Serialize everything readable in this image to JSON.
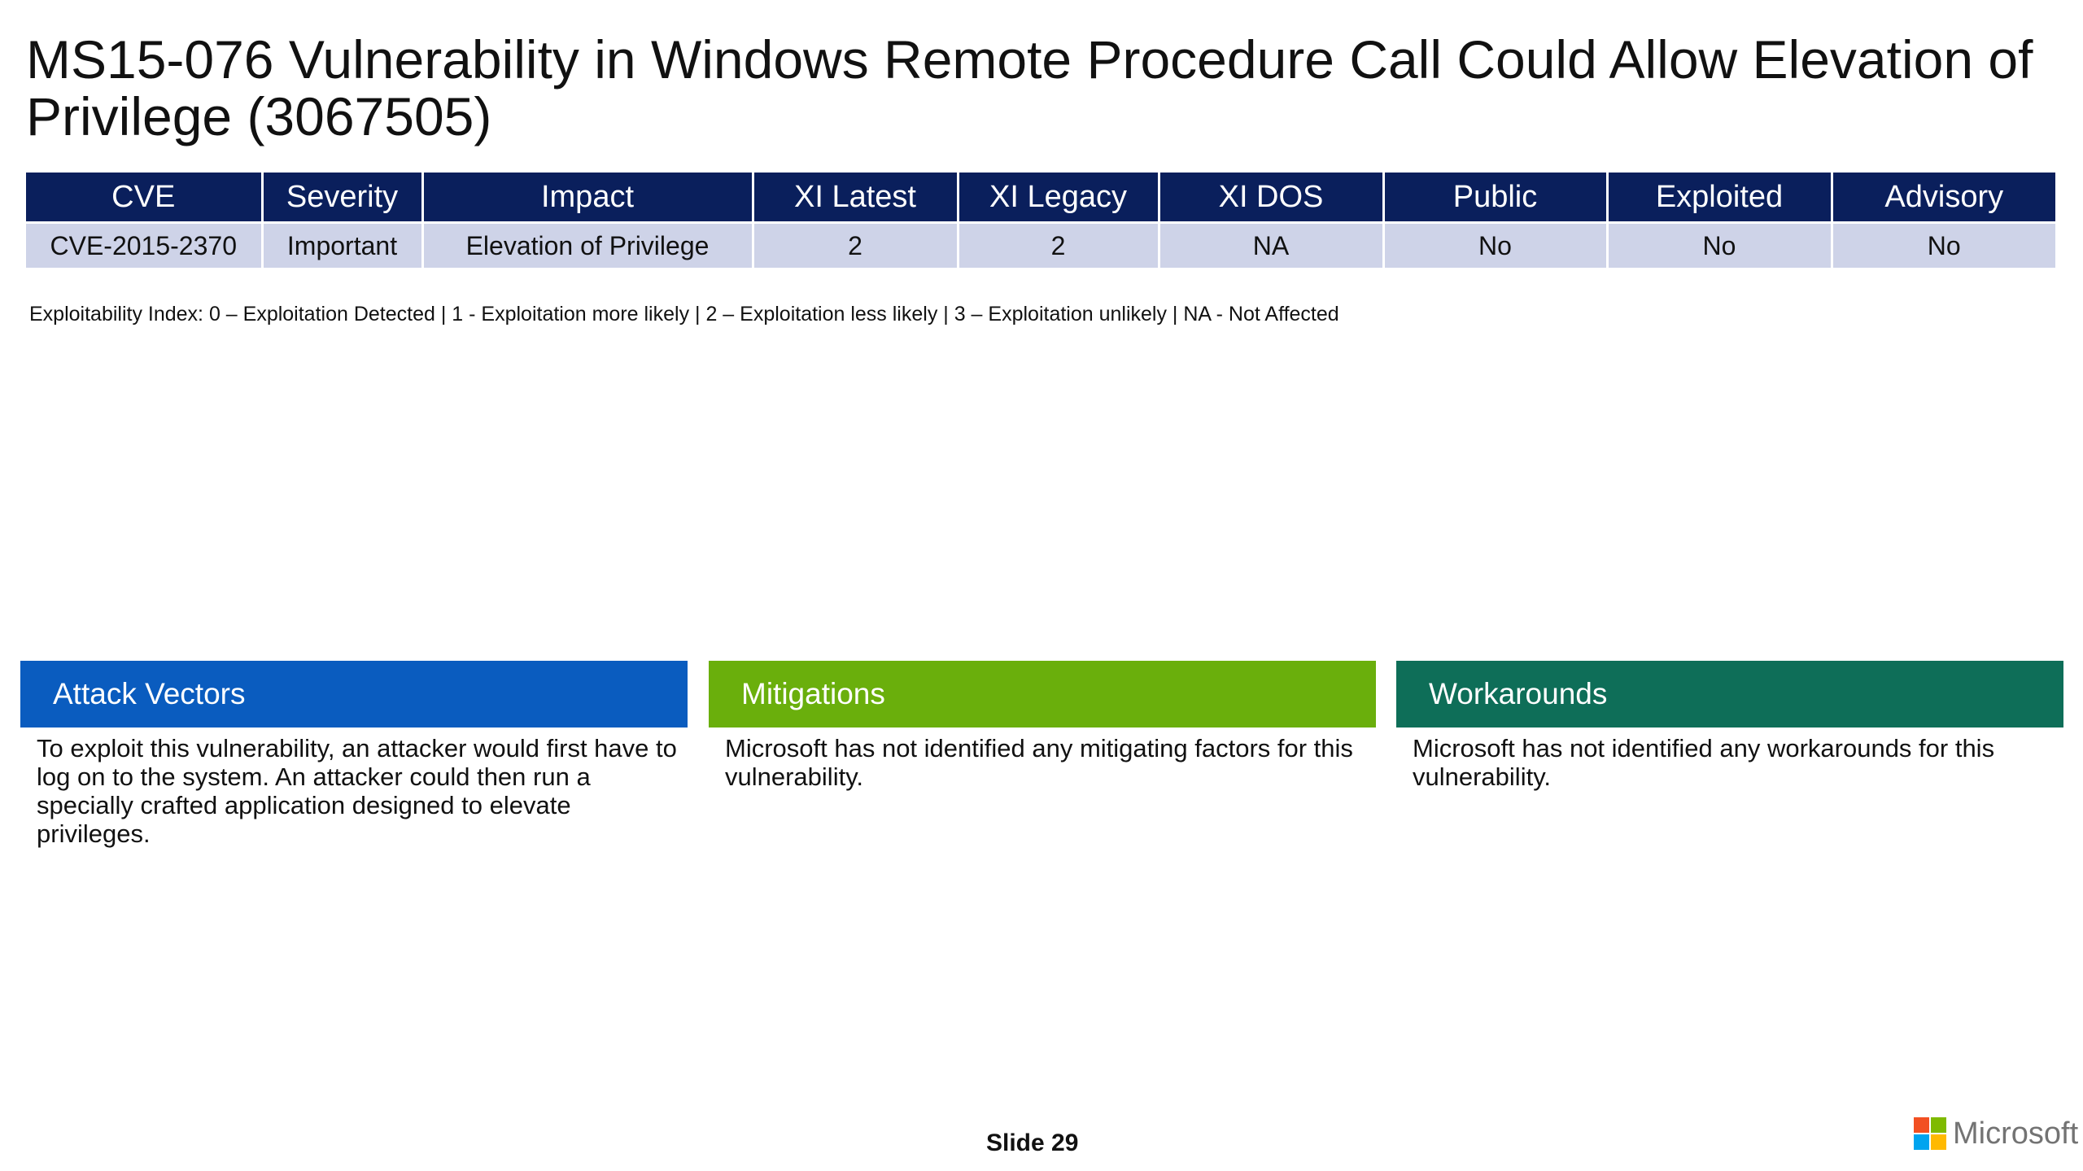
{
  "slide": {
    "title": "MS15-076 Vulnerability in Windows Remote Procedure Call Could Allow Elevation of Privilege (3067505)",
    "slide_number": "Slide 29"
  },
  "table": {
    "headers": [
      "CVE",
      "Severity",
      "Impact",
      "XI Latest",
      "XI Legacy",
      "XI DOS",
      "Public",
      "Exploited",
      "Advisory"
    ],
    "rows": [
      [
        "CVE-2015-2370",
        "Important",
        "Elevation of Privilege",
        "2",
        "2",
        "NA",
        "No",
        "No",
        "No"
      ]
    ]
  },
  "legend": "Exploitability Index: 0 – Exploitation Detected | 1 - Exploitation more likely  | 2 – Exploitation less likely  | 3 – Exploitation unlikely | NA - Not Affected",
  "panels": {
    "attack": {
      "title": "Attack Vectors",
      "body": "To exploit this vulnerability, an attacker would first have to log on to the system. An attacker could then run a specially crafted application designed to elevate privileges."
    },
    "mitigations": {
      "title": "Mitigations",
      "body": "Microsoft has not identified any  mitigating factors for this vulnerability."
    },
    "workarounds": {
      "title": "Workarounds",
      "body": "Microsoft has not identified any workarounds for this vulnerability."
    }
  },
  "logo": {
    "wordmark": "Microsoft",
    "icon": "microsoft-logo-icon"
  },
  "colors": {
    "table_header": "#0a1f5c",
    "table_row": "#ced3e8",
    "attack": "#0a5cbf",
    "mitigations": "#6aaf0c",
    "workarounds": "#0e6e58"
  }
}
